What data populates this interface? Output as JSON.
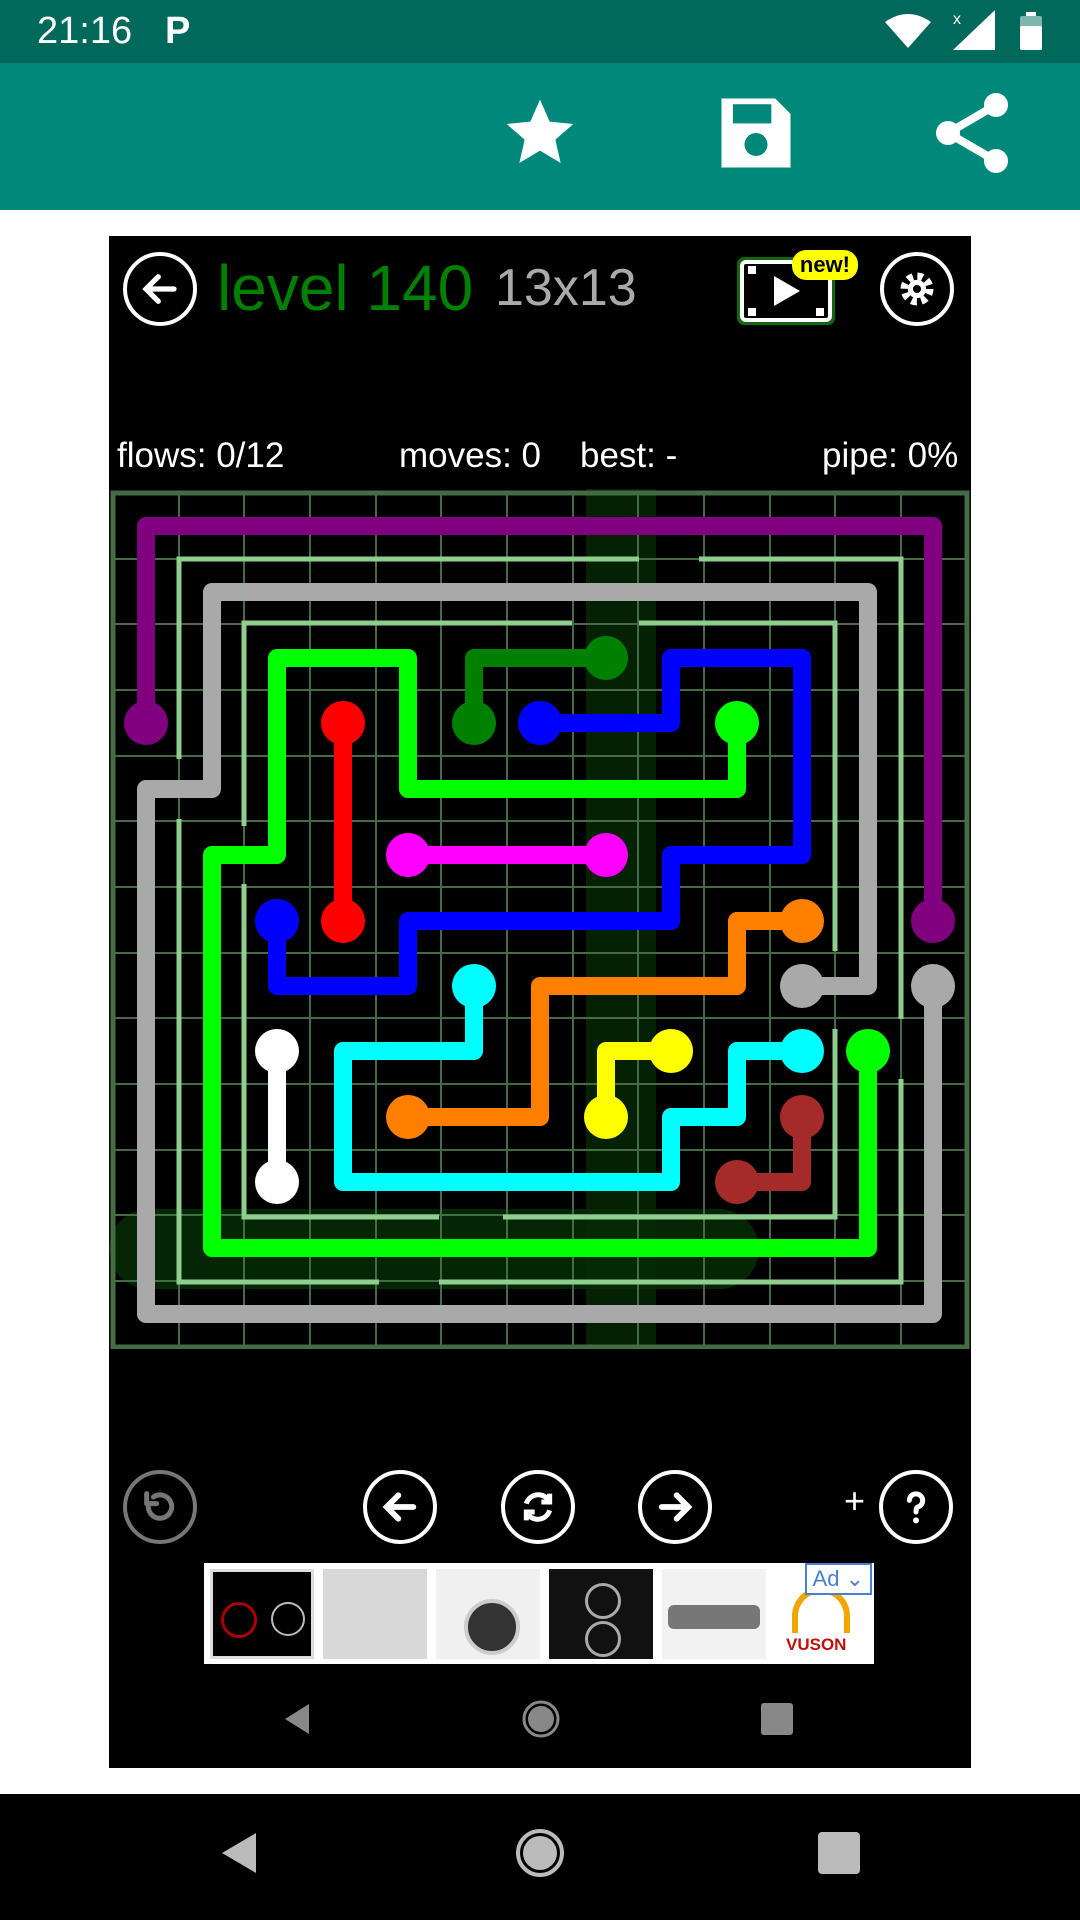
{
  "status_bar": {
    "time": "21:16",
    "p_icon": "P"
  },
  "toolbar": {
    "icons": [
      "star-icon",
      "save-icon",
      "share-icon"
    ]
  },
  "game": {
    "level_label": "level 140",
    "grid_size": "13x13",
    "new_badge": "new!",
    "stats": {
      "flows": "flows: 0/12",
      "moves": "moves: 0",
      "best": "best: -",
      "pipe": "pipe: 0%"
    },
    "colors": {
      "purple": "#800080",
      "green_dark": "#008000",
      "blue": "#0000ff",
      "lime": "#00ff00",
      "red": "#ff0000",
      "magenta": "#ff00ff",
      "orange": "#ff8000",
      "cyan": "#00ffff",
      "yellow": "#ffff00",
      "white": "#ffffff",
      "gray": "#a9a9a9",
      "maroon": "#a52a2a"
    },
    "bottom_plus": "+",
    "ad_badge": "Ad",
    "ad_brand": "VUSON"
  }
}
